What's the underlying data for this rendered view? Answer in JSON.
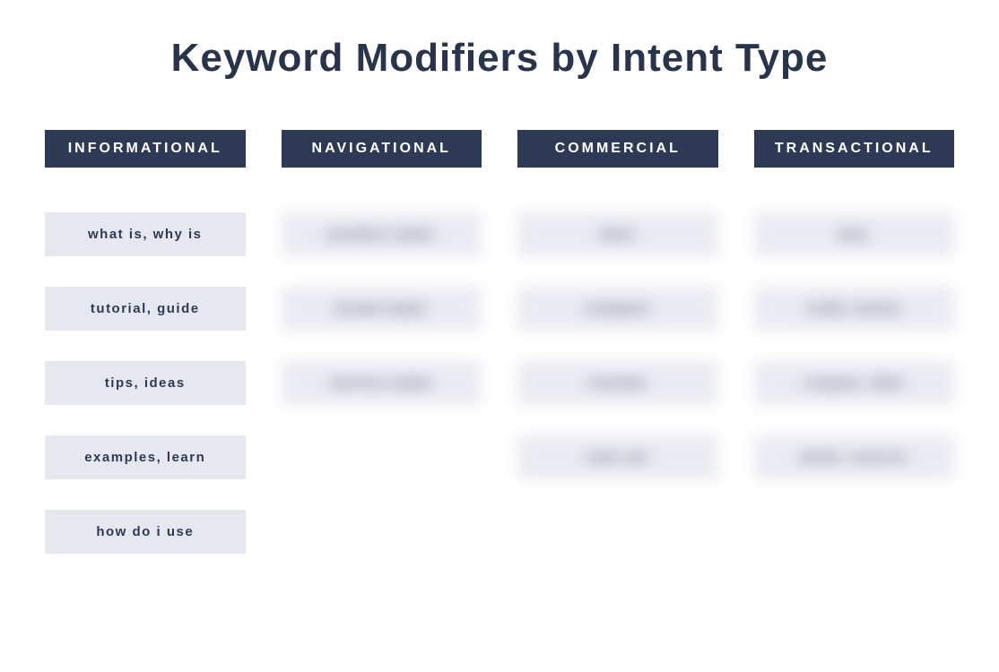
{
  "title": "Keyword Modifiers by Intent Type",
  "columns": [
    {
      "header": "INFORMATIONAL",
      "blurred": false,
      "items": [
        "what is, why is",
        "tutorial, guide",
        "tips, ideas",
        "examples, learn",
        "how do i use"
      ]
    },
    {
      "header": "NAVIGATIONAL",
      "blurred": true,
      "items": [
        "product name",
        "brand name",
        "service name"
      ]
    },
    {
      "header": "COMMERCIAL",
      "blurred": true,
      "items": [
        "best",
        "compare",
        "reviews",
        "near me"
      ]
    },
    {
      "header": "TRANSACTIONAL",
      "blurred": true,
      "items": [
        "buy",
        "order online",
        "coupon, deal",
        "book, reserve"
      ]
    }
  ]
}
